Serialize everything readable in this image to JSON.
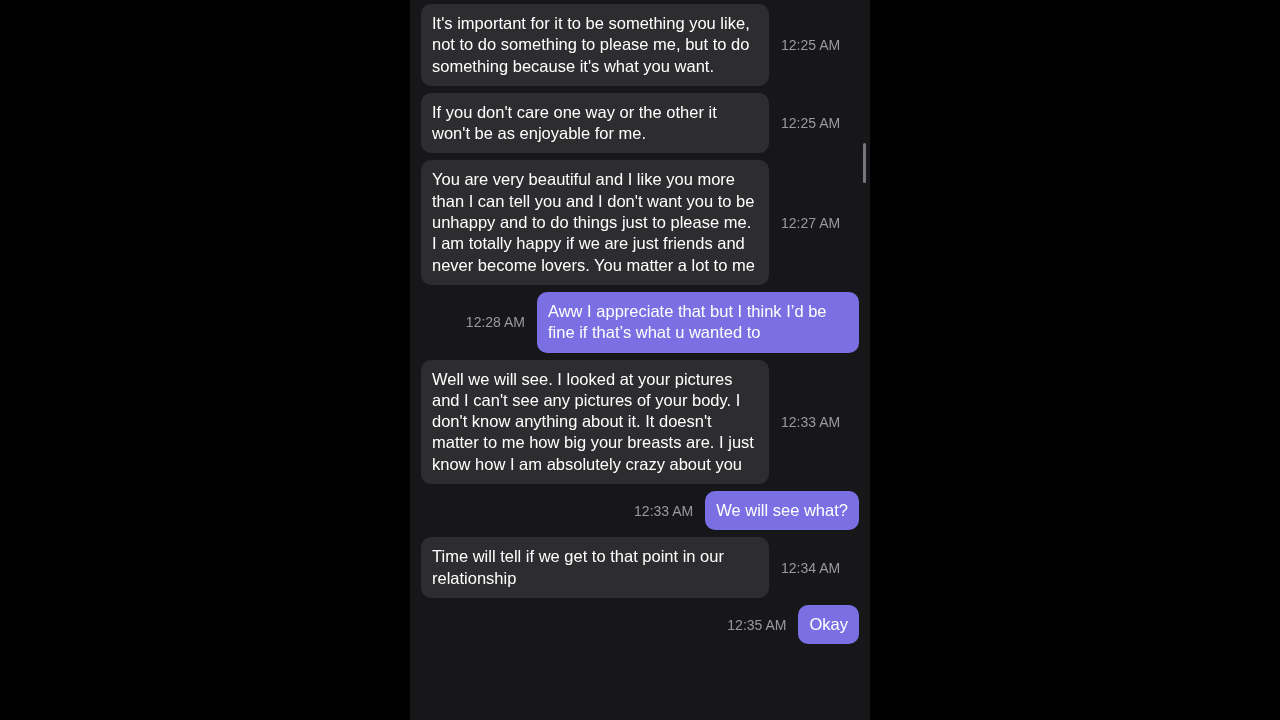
{
  "messages": [
    {
      "kind": "received",
      "text": "It's important for it to be something you like, not to do something to please me, but to do something because it's what you want.",
      "time": "12:25 AM"
    },
    {
      "kind": "received",
      "text": "If you don't care one way or the other it won't be as enjoyable for me.",
      "time": "12:25 AM"
    },
    {
      "kind": "received",
      "text": "You are very beautiful and I like you more than I can tell you and I don't want you to be unhappy and to do things just to please me. I am totally happy if we are just friends and never become lovers. You matter a lot to me",
      "time": "12:27 AM"
    },
    {
      "kind": "sent",
      "text": "Aww I appreciate that but I think I’d be fine if that’s what u wanted to",
      "time": "12:28 AM"
    },
    {
      "kind": "received",
      "text": "Well we will see. I looked at your pictures and I can't see any pictures of your body. I don't know anything about it. It doesn't matter to me how big your breasts are. I just know how I am absolutely crazy about you",
      "time": "12:33 AM"
    },
    {
      "kind": "sent",
      "text": "We will see what?",
      "time": "12:33 AM"
    },
    {
      "kind": "received",
      "text": "Time will tell if we get to that point in our relationship",
      "time": "12:34 AM"
    },
    {
      "kind": "sent",
      "text": "Okay",
      "time": "12:35 AM"
    }
  ]
}
